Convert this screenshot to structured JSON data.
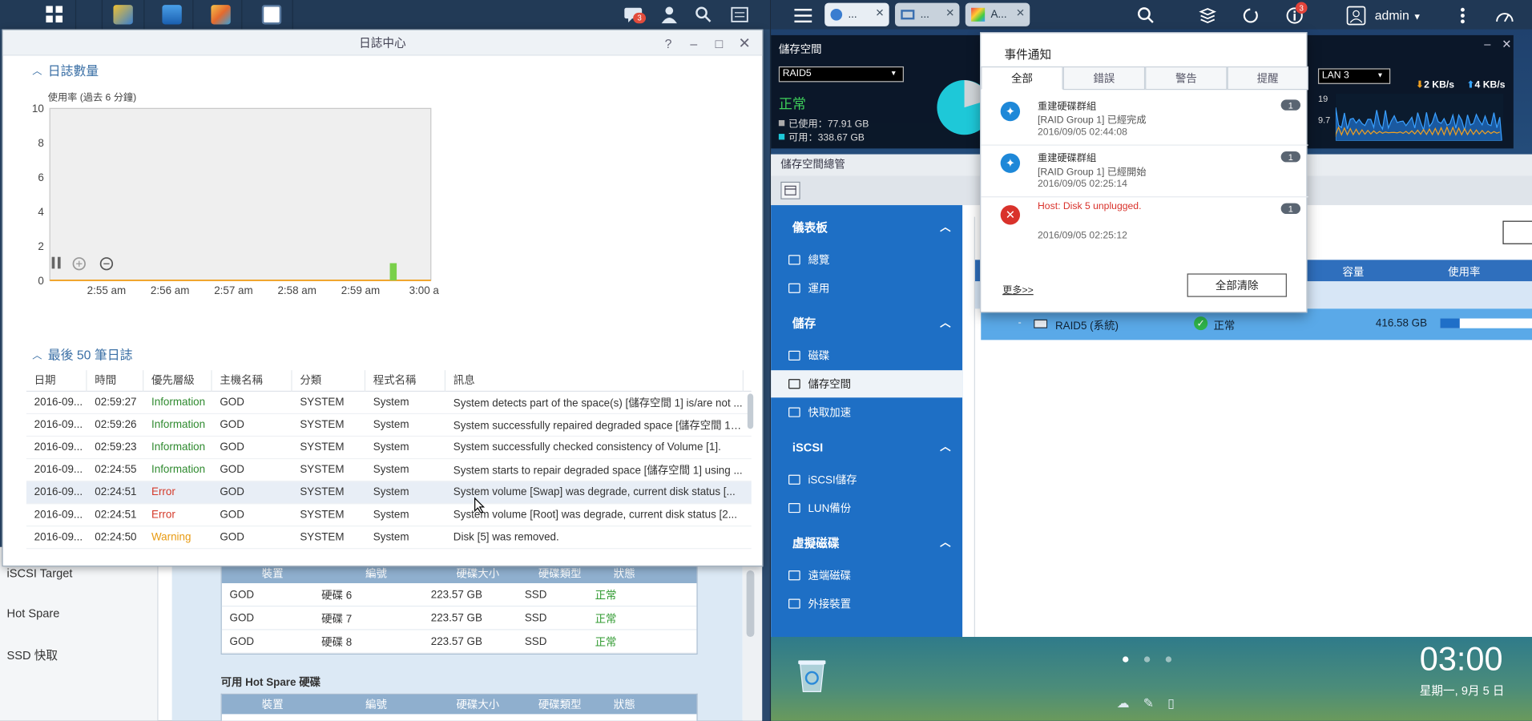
{
  "synology": {
    "taskbar": {
      "notification_count": "3"
    },
    "log_window": {
      "title": "日誌中心",
      "section_log_count": "日誌數量",
      "usage_caption": "使用率 (過去 6 分鐘)",
      "section_recent": "最後 50 筆日誌",
      "columns": [
        "日期",
        "時間",
        "優先層級",
        "主機名稱",
        "分類",
        "程式名稱",
        "訊息"
      ],
      "rows": [
        {
          "date": "2016-09...",
          "time": "02:59:27",
          "level": "Information",
          "host": "GOD",
          "category": "SYSTEM",
          "program": "System",
          "message": "System detects part of the space(s) [儲存空間 1] is/are not ..."
        },
        {
          "date": "2016-09...",
          "time": "02:59:26",
          "level": "Information",
          "host": "GOD",
          "category": "SYSTEM",
          "program": "System",
          "message": "System successfully repaired degraded space [儲存空間 1] u..."
        },
        {
          "date": "2016-09...",
          "time": "02:59:23",
          "level": "Information",
          "host": "GOD",
          "category": "SYSTEM",
          "program": "System",
          "message": "System successfully checked consistency of Volume [1]."
        },
        {
          "date": "2016-09...",
          "time": "02:24:55",
          "level": "Information",
          "host": "GOD",
          "category": "SYSTEM",
          "program": "System",
          "message": "System starts to repair degraded space [儲存空間 1] using ..."
        },
        {
          "date": "2016-09...",
          "time": "02:24:51",
          "level": "Error",
          "host": "GOD",
          "category": "SYSTEM",
          "program": "System",
          "message": "System volume [Swap] was degrade, current disk status [..."
        },
        {
          "date": "2016-09...",
          "time": "02:24:51",
          "level": "Error",
          "host": "GOD",
          "category": "SYSTEM",
          "program": "System",
          "message": "System volume [Root] was degrade, current disk status [2..."
        },
        {
          "date": "2016-09...",
          "time": "02:24:50",
          "level": "Warning",
          "host": "GOD",
          "category": "SYSTEM",
          "program": "System",
          "message": "Disk [5] was removed."
        }
      ]
    },
    "chart_data": {
      "type": "bar",
      "title": "",
      "ylabel": "",
      "ylim": [
        0,
        10
      ],
      "yticks": [
        0,
        2,
        4,
        6,
        8,
        10
      ],
      "xticks": [
        "2:55 am",
        "2:56 am",
        "2:57 am",
        "2:58 am",
        "2:59 am",
        "3:00 a"
      ],
      "series": [
        {
          "values": [
            {
              "x": "2:59:27 am",
              "y": 1
            }
          ]
        }
      ],
      "grid": false
    },
    "storage_bg": {
      "sidebar": [
        "iSCSI Target",
        "Hot Spare",
        "SSD 快取"
      ],
      "disk_table": {
        "columns": [
          "裝置",
          "編號",
          "硬碟大小",
          "硬碟類型",
          "狀態"
        ],
        "rows": [
          {
            "device": "GOD",
            "id": "硬碟 6",
            "size": "223.57 GB",
            "type": "SSD",
            "status": "正常"
          },
          {
            "device": "GOD",
            "id": "硬碟 7",
            "size": "223.57 GB",
            "type": "SSD",
            "status": "正常"
          },
          {
            "device": "GOD",
            "id": "硬碟 8",
            "size": "223.57 GB",
            "type": "SSD",
            "status": "正常"
          }
        ]
      },
      "hotspare_title": "可用 Hot Spare 硬碟",
      "hotspare_columns": [
        "裝置",
        "編號",
        "硬碟大小",
        "硬碟類型",
        "狀態"
      ]
    }
  },
  "qnap": {
    "topbar": {
      "tabs": [
        "...",
        "...",
        "A..."
      ],
      "notification_count": "3",
      "user": "admin"
    },
    "storage_widget": {
      "title": "儲存空間",
      "pool_select": "RAID5",
      "status": "正常",
      "used": "已使用：77.91 GB",
      "free": "可用：338.67 GB",
      "net_select": "LAN 3",
      "down_speed": "2 KB/s",
      "up_speed": "4 KB/s",
      "y_top": "19",
      "y_mid": "9.7"
    },
    "storage_manager": {
      "title": "儲存空間總管",
      "groups": [
        {
          "label": "儀表板",
          "items": [
            "總覽",
            "運用"
          ]
        },
        {
          "label": "儲存",
          "items": [
            "磁碟",
            "儲存空間",
            "快取加速"
          ]
        },
        {
          "label": "iSCSI",
          "items": [
            "iSCSI儲存",
            "LUN備份"
          ]
        },
        {
          "label": "虛擬磁碟",
          "items": [
            "遠端磁碟",
            "外接裝置"
          ]
        }
      ],
      "col_capacity": "容量",
      "col_usage": "使用率",
      "row": {
        "name": "RAID5 (系統)",
        "status": "正常",
        "capacity": "416.58 GB"
      }
    },
    "notifications": {
      "title": "事件通知",
      "tabs": [
        "全部",
        "錯誤",
        "警告",
        "提醒"
      ],
      "items": [
        {
          "title": "重建硬碟群組",
          "detail": "[RAID Group 1] 已經完成",
          "time": "2016/09/05 02:44:08",
          "count": "1",
          "kind": "info"
        },
        {
          "title": "重建硬碟群組",
          "detail": "[RAID Group 1] 已經開始",
          "time": "2016/09/05 02:25:14",
          "count": "1",
          "kind": "info"
        },
        {
          "title": "Host: Disk 5 unplugged.",
          "detail": "",
          "time": "2016/09/05 02:25:12",
          "count": "1",
          "kind": "error"
        }
      ],
      "more": "更多>>",
      "clear_all": "全部清除"
    },
    "desktop": {
      "clock": "03:00",
      "date": "星期一, 9月 5 日"
    }
  }
}
